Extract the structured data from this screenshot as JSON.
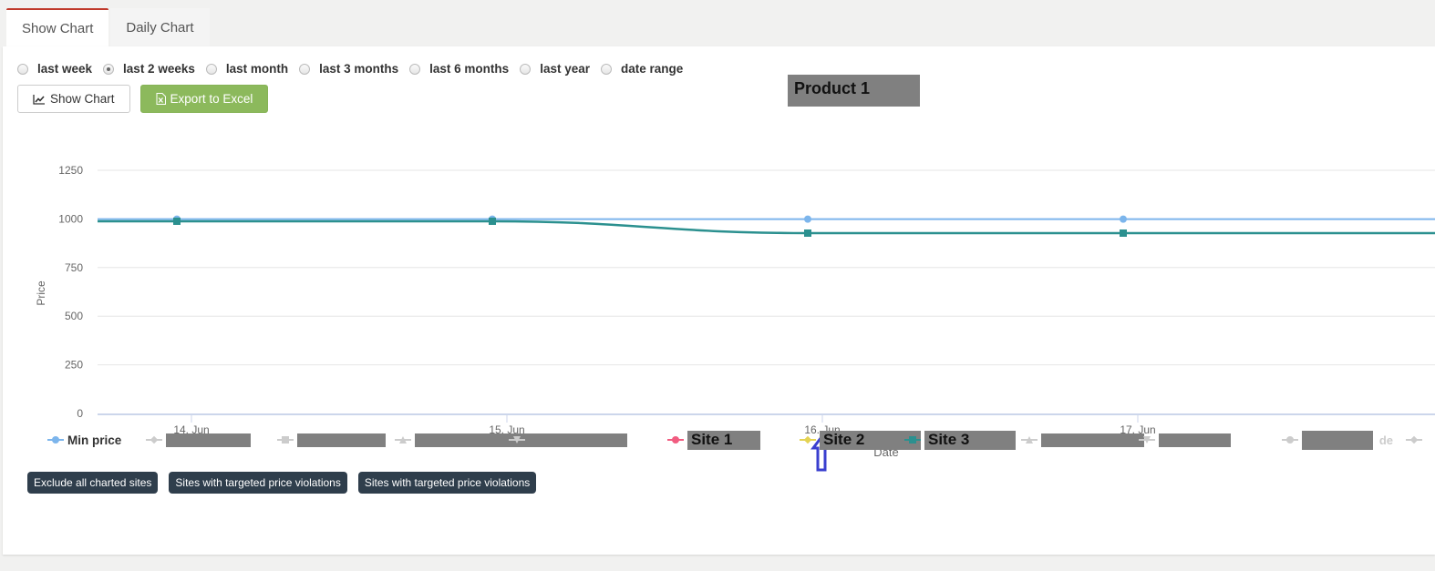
{
  "tabs": [
    {
      "label": "Show Chart",
      "active": true
    },
    {
      "label": "Daily Chart",
      "active": false
    }
  ],
  "range_options": [
    {
      "label": "last week",
      "checked": false
    },
    {
      "label": "last 2 weeks",
      "checked": true
    },
    {
      "label": "last month",
      "checked": false
    },
    {
      "label": "last 3 months",
      "checked": false
    },
    {
      "label": "last 6 months",
      "checked": false
    },
    {
      "label": "last year",
      "checked": false
    },
    {
      "label": "date range",
      "checked": false
    }
  ],
  "buttons": {
    "show_chart": "Show Chart",
    "export_excel": "Export to Excel"
  },
  "icons": {
    "show_chart": "line-chart-icon",
    "export_excel": "excel-file-icon",
    "annotation": "up-arrow-icon"
  },
  "colors": {
    "min_price": "#7cb5ec",
    "site1": "#f15c80",
    "site2": "#e4d354",
    "site3": "#2b908f",
    "inactive": "#cccccc",
    "accent_tab": "#c0392b",
    "export_button": "#8cb95c",
    "action_button": "#2f3e4c",
    "annotation_arrow": "#3a3fcf"
  },
  "chart_data": {
    "type": "line",
    "title": "Product 1",
    "xlabel": "Date",
    "ylabel": "Price",
    "ylim": [
      0,
      1250
    ],
    "yticks": [
      0,
      250,
      500,
      750,
      1000,
      1250
    ],
    "xticks": [
      "14. Jun",
      "15. Jun",
      "16. Jun",
      "17. Jun"
    ],
    "x": [
      "14. Jun",
      "15. Jun",
      "16. Jun",
      "17. Jun"
    ],
    "grid": true,
    "legend_position": "bottom",
    "series": [
      {
        "name": "Min price",
        "color": "#7cb5ec",
        "marker": "circle",
        "values": [
          999,
          999,
          999,
          999
        ]
      },
      {
        "name": "Site 3",
        "color": "#2b908f",
        "marker": "square",
        "values": [
          988,
          988,
          927,
          927
        ]
      }
    ],
    "annotation": "arrow pointing at 16. Jun"
  },
  "legend": [
    {
      "label": "Min price",
      "color": "#7cb5ec",
      "marker": "circle",
      "active": true,
      "redacted": false
    },
    {
      "label": "",
      "color": "#cccccc",
      "marker": "diamond",
      "active": false,
      "redacted": true
    },
    {
      "label": "",
      "color": "#cccccc",
      "marker": "square",
      "active": false,
      "redacted": true
    },
    {
      "label": "",
      "color": "#cccccc",
      "marker": "triangle",
      "active": false,
      "redacted": true
    },
    {
      "label": "",
      "color": "#cccccc",
      "marker": "triangle-down",
      "active": false,
      "redacted": true
    },
    {
      "label": "Site 1",
      "color": "#f15c80",
      "marker": "circle",
      "active": true,
      "redacted": true
    },
    {
      "label": "Site 2",
      "color": "#e4d354",
      "marker": "diamond",
      "active": true,
      "redacted": true
    },
    {
      "label": "Site 3",
      "color": "#2b908f",
      "marker": "square",
      "active": true,
      "redacted": true
    },
    {
      "label": "",
      "color": "#cccccc",
      "marker": "triangle",
      "active": false,
      "redacted": true
    },
    {
      "label": "",
      "color": "#cccccc",
      "marker": "triangle-down",
      "active": false,
      "redacted": true
    },
    {
      "label": "de",
      "color": "#cccccc",
      "marker": "circle",
      "active": false,
      "redacted": true
    },
    {
      "label": "",
      "color": "#cccccc",
      "marker": "diamond",
      "active": false,
      "redacted": false
    }
  ],
  "actions": [
    "Exclude all charted sites",
    "Sites with targeted price violations",
    "Sites with targeted price violations"
  ]
}
